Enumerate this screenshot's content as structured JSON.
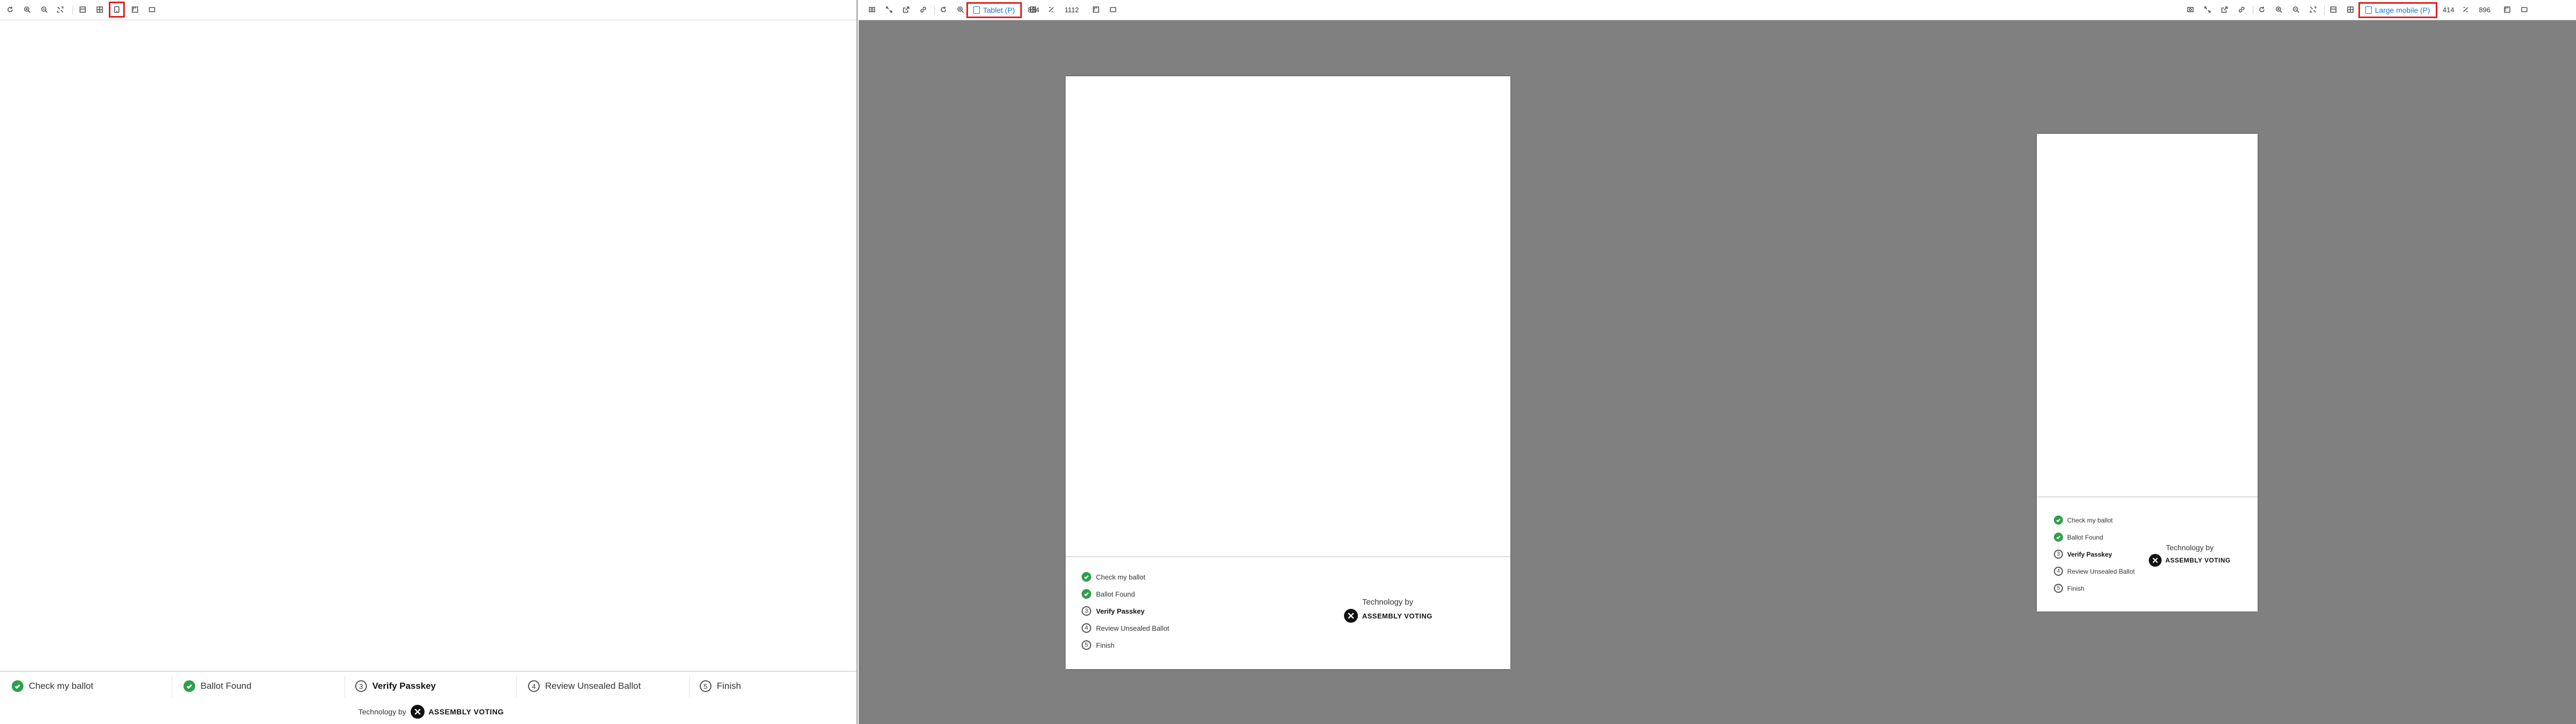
{
  "desktop": {
    "toolbar": {
      "icons": [
        "refresh-icon",
        "zoom-in-icon",
        "zoom-out-icon",
        "fit-icon",
        "layout-icon",
        "grid-icon",
        "tablet-icon",
        "ruler-icon",
        "frame-icon"
      ]
    },
    "steps": [
      {
        "label": "Check my ballot",
        "status": "done"
      },
      {
        "label": "Ballot Found",
        "status": "done"
      },
      {
        "number": "3",
        "label": "Verify Passkey",
        "status": "current"
      },
      {
        "number": "4",
        "label": "Review Unsealed Ballot",
        "status": "pending"
      },
      {
        "number": "5",
        "label": "Finish",
        "status": "pending"
      }
    ],
    "tech_prefix": "Technology by",
    "brand": "ASSEMBLY VOTING"
  },
  "tablet": {
    "device_label": "Tablet (P)",
    "width": "834",
    "height": "1112",
    "steps": [
      {
        "label": "Check my ballot",
        "status": "done"
      },
      {
        "label": "Ballot Found",
        "status": "done"
      },
      {
        "number": "3",
        "label": "Verify Passkey",
        "status": "current"
      },
      {
        "number": "4",
        "label": "Review Unsealed Ballot",
        "status": "pending"
      },
      {
        "number": "5",
        "label": "Finish",
        "status": "pending"
      }
    ],
    "tech_prefix": "Technology by",
    "brand": "ASSEMBLY VOTING"
  },
  "mobile": {
    "device_label": "Large mobile (P)",
    "width": "414",
    "height": "896",
    "steps": [
      {
        "label": "Check my ballot",
        "status": "done"
      },
      {
        "label": "Ballot Found",
        "status": "done"
      },
      {
        "number": "3",
        "label": "Verify Passkey",
        "status": "current"
      },
      {
        "number": "4",
        "label": "Review Unsealed Ballot",
        "status": "pending"
      },
      {
        "number": "5",
        "label": "Finish",
        "status": "pending"
      }
    ],
    "tech_prefix": "Technology by",
    "brand": "ASSEMBLY VOTING"
  },
  "colors": {
    "accent": "#1a73e8",
    "highlight": "#e02020",
    "success": "#2e9f4b",
    "canvas": "#808080"
  }
}
